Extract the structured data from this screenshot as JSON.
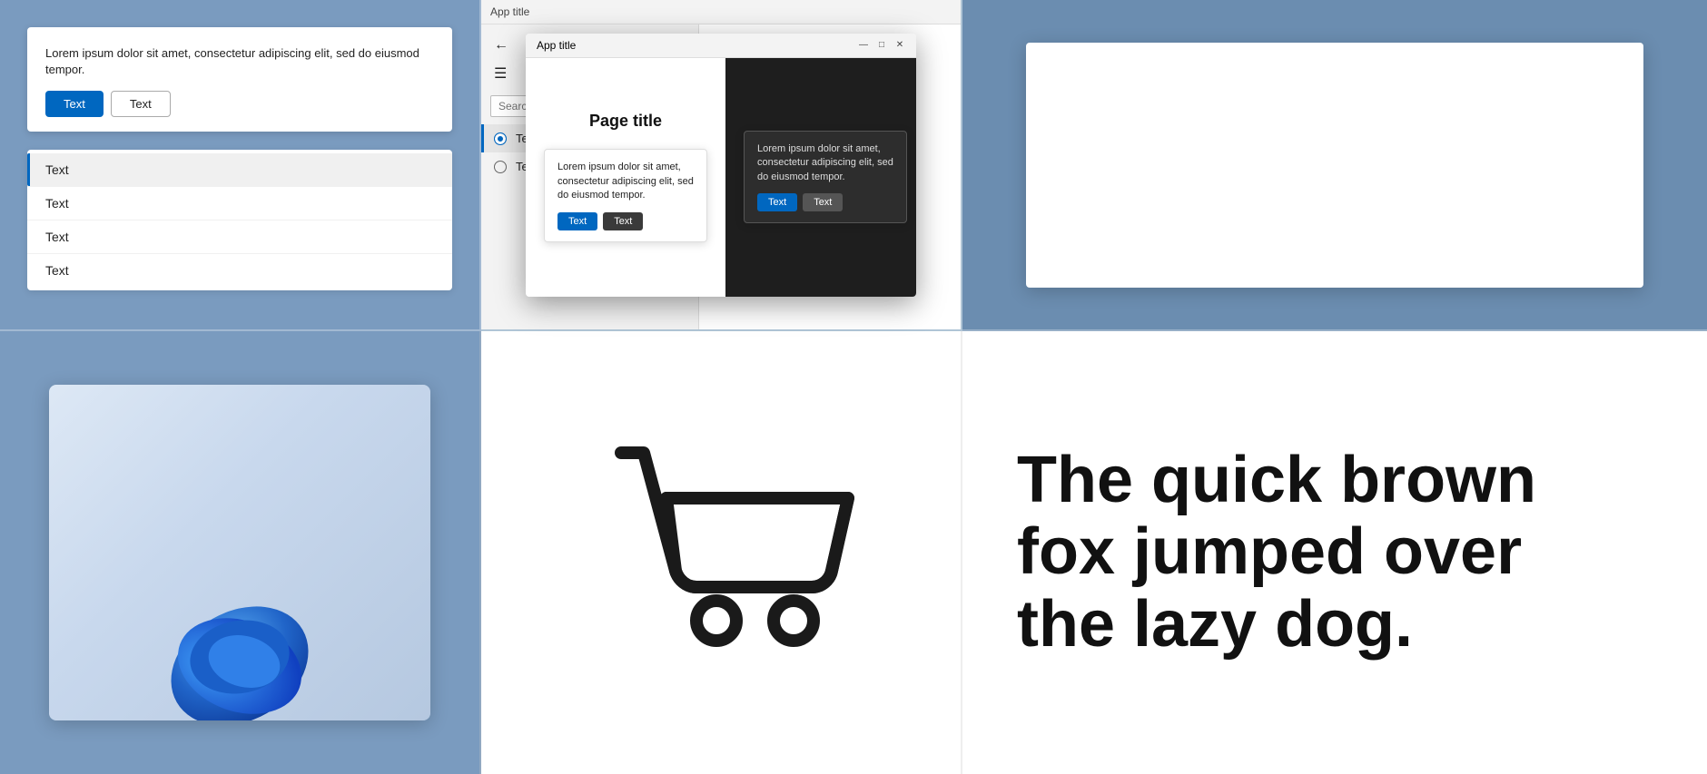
{
  "tl": {
    "dialog": {
      "body_text": "Lorem ipsum dolor sit amet, consectetur adipiscing elit, sed do eiusmod tempor.",
      "btn_primary": "Text",
      "btn_secondary": "Text"
    },
    "list": {
      "items": [
        {
          "label": "Text",
          "selected": true
        },
        {
          "label": "Text",
          "selected": false
        },
        {
          "label": "Text",
          "selected": false
        },
        {
          "label": "Text",
          "selected": false
        }
      ]
    }
  },
  "tm": {
    "app_title": "App title",
    "search_placeholder": "Search",
    "nav_items": [
      {
        "label": "Text",
        "active": true
      },
      {
        "label": "Text",
        "active": false
      }
    ],
    "page_title": "Page title"
  },
  "modal": {
    "title": "App title",
    "page_title": "Page title",
    "dialog_text": "Lorem ipsum dolor sit amet, consectetur adipiscing elit, sed do eiusmod tempor.",
    "btn_primary": "Text",
    "btn_secondary": "Text"
  },
  "bottom": {
    "tagline": "The quick brown fox jumped over the lazy dog.",
    "cart_icon": "cart-icon"
  }
}
